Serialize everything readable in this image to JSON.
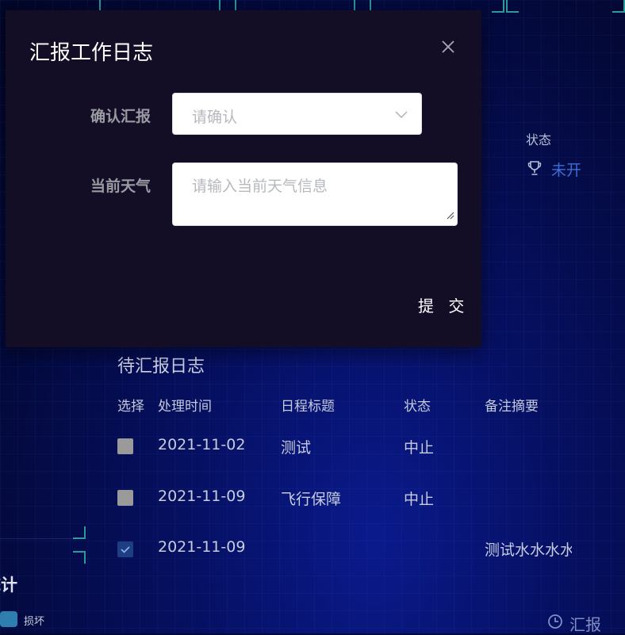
{
  "dialog": {
    "title": "汇报工作日志",
    "close_icon": "close-icon",
    "confirm_field": {
      "label": "确认汇报",
      "placeholder": "请确认",
      "icon": "chevron-down-icon"
    },
    "weather_field": {
      "label": "当前天气",
      "placeholder": "请输入当前天气信息"
    },
    "submit_label": "提 交"
  },
  "background": {
    "status_header": "状态",
    "status_icon": "trophy-icon",
    "status_value": "未开",
    "pending_title": "待汇报日志",
    "table": {
      "headers": [
        "选择",
        "处理时间",
        "日程标题",
        "状态",
        "备注摘要"
      ],
      "rows": [
        {
          "checked": false,
          "time": "2021-11-02",
          "title": "测试",
          "status": "中止",
          "note": ""
        },
        {
          "checked": false,
          "time": "2021-11-09",
          "title": "飞行保障",
          "status": "中止",
          "note": ""
        },
        {
          "checked": true,
          "time": "2021-11-09",
          "title": "",
          "status": "",
          "note": "测试水水水水"
        }
      ]
    },
    "left_stat_title": "统计",
    "legend_label": "损坏",
    "report_link": {
      "icon": "clock-icon",
      "label": "汇报"
    }
  },
  "colors": {
    "accent": "#3b6fd6",
    "modal_bg": "#130e26",
    "checked": "#1d3e82"
  }
}
